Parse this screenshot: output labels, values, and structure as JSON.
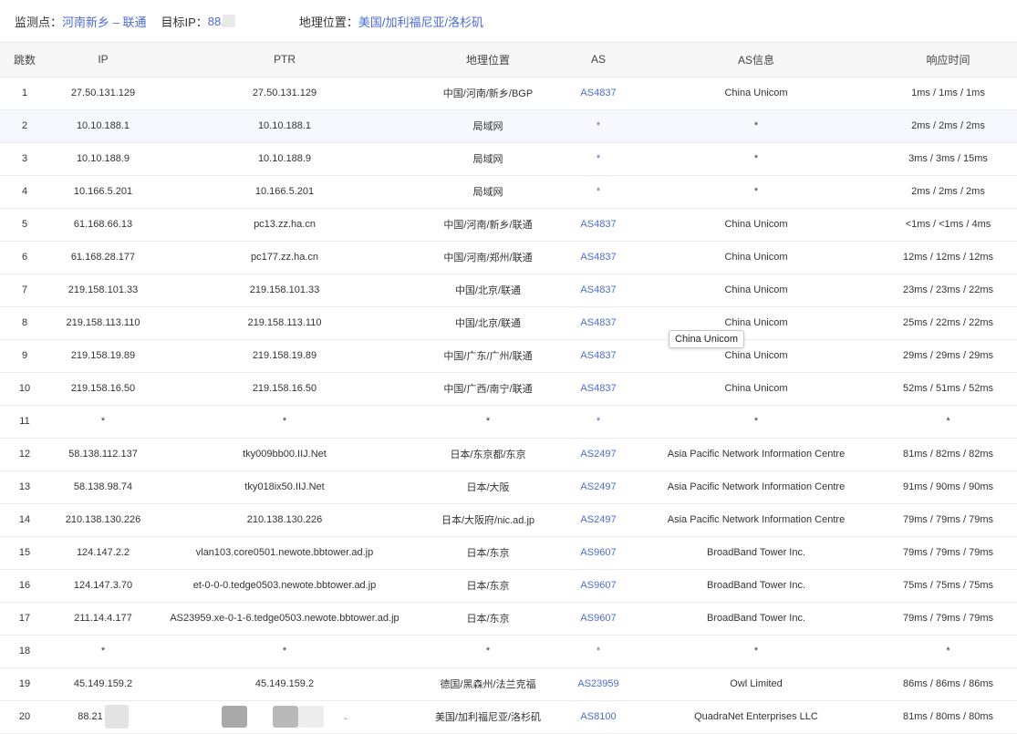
{
  "header": {
    "monitor_label": "监测点：",
    "monitor_value": "河南新乡 – 联通",
    "target_label": "目标IP：",
    "target_value": "88.",
    "geo_label": "地理位置：",
    "geo_value": "美国/加利福尼亚/洛杉矶"
  },
  "table": {
    "columns": [
      "跳数",
      "IP",
      "PTR",
      "地理位置",
      "AS",
      "AS信息",
      "响应时间"
    ],
    "rows": [
      {
        "hop": "1",
        "ip": "27.50.131.129",
        "ptr": "27.50.131.129",
        "geo": "中国/河南/新乡/BGP",
        "as": "AS4837",
        "asinfo": "China Unicom",
        "time": "1ms / 1ms / 1ms"
      },
      {
        "hop": "2",
        "ip": "10.10.188.1",
        "ptr": "10.10.188.1",
        "geo": "局域网",
        "as": "*",
        "asinfo": "*",
        "time": "2ms / 2ms / 2ms"
      },
      {
        "hop": "3",
        "ip": "10.10.188.9",
        "ptr": "10.10.188.9",
        "geo": "局域网",
        "as": "*",
        "asinfo": "*",
        "time": "3ms / 3ms / 15ms"
      },
      {
        "hop": "4",
        "ip": "10.166.5.201",
        "ptr": "10.166.5.201",
        "geo": "局域网",
        "as": "*",
        "asinfo": "*",
        "time": "2ms / 2ms / 2ms"
      },
      {
        "hop": "5",
        "ip": "61.168.66.13",
        "ptr": "pc13.zz.ha.cn",
        "geo": "中国/河南/新乡/联通",
        "as": "AS4837",
        "asinfo": "China Unicom",
        "time": "<1ms / <1ms / 4ms"
      },
      {
        "hop": "6",
        "ip": "61.168.28.177",
        "ptr": "pc177.zz.ha.cn",
        "geo": "中国/河南/郑州/联通",
        "as": "AS4837",
        "asinfo": "China Unicom",
        "time": "12ms / 12ms / 12ms"
      },
      {
        "hop": "7",
        "ip": "219.158.101.33",
        "ptr": "219.158.101.33",
        "geo": "中国/北京/联通",
        "as": "AS4837",
        "asinfo": "China Unicom",
        "time": "23ms / 23ms / 22ms"
      },
      {
        "hop": "8",
        "ip": "219.158.113.110",
        "ptr": "219.158.113.110",
        "geo": "中国/北京/联通",
        "as": "AS4837",
        "asinfo": "China Unicom",
        "time": "25ms / 22ms / 22ms"
      },
      {
        "hop": "9",
        "ip": "219.158.19.89",
        "ptr": "219.158.19.89",
        "geo": "中国/广东/广州/联通",
        "as": "AS4837",
        "asinfo": "China Unicom",
        "time": "29ms / 29ms / 29ms"
      },
      {
        "hop": "10",
        "ip": "219.158.16.50",
        "ptr": "219.158.16.50",
        "geo": "中国/广西/南宁/联通",
        "as": "AS4837",
        "asinfo": "China Unicom",
        "time": "52ms / 51ms / 52ms"
      },
      {
        "hop": "11",
        "ip": "*",
        "ptr": "*",
        "geo": "*",
        "as": "*",
        "asinfo": "*",
        "time": "*"
      },
      {
        "hop": "12",
        "ip": "58.138.112.137",
        "ptr": "tky009bb00.IIJ.Net",
        "geo": "日本/东京都/东京",
        "as": "AS2497",
        "asinfo": "Asia Pacific Network Information Centre",
        "time": "81ms / 82ms / 82ms"
      },
      {
        "hop": "13",
        "ip": "58.138.98.74",
        "ptr": "tky018ix50.IIJ.Net",
        "geo": "日本/大阪",
        "as": "AS2497",
        "asinfo": "Asia Pacific Network Information Centre",
        "time": "91ms / 90ms / 90ms"
      },
      {
        "hop": "14",
        "ip": "210.138.130.226",
        "ptr": "210.138.130.226",
        "geo": "日本/大阪府/nic.ad.jp",
        "as": "AS2497",
        "asinfo": "Asia Pacific Network Information Centre",
        "time": "79ms / 79ms / 79ms"
      },
      {
        "hop": "15",
        "ip": "124.147.2.2",
        "ptr": "vlan103.core0501.newote.bbtower.ad.jp",
        "geo": "日本/东京",
        "as": "AS9607",
        "asinfo": "BroadBand Tower Inc.",
        "time": "79ms / 79ms / 79ms"
      },
      {
        "hop": "16",
        "ip": "124.147.3.70",
        "ptr": "et-0-0-0.tedge0503.newote.bbtower.ad.jp",
        "geo": "日本/东京",
        "as": "AS9607",
        "asinfo": "BroadBand Tower Inc.",
        "time": "75ms / 75ms / 75ms"
      },
      {
        "hop": "17",
        "ip": "211.14.4.177",
        "ptr": "AS23959.xe-0-1-6.tedge0503.newote.bbtower.ad.jp",
        "geo": "日本/东京",
        "as": "AS9607",
        "asinfo": "BroadBand Tower Inc.",
        "time": "79ms / 79ms / 79ms"
      },
      {
        "hop": "18",
        "ip": "*",
        "ptr": "*",
        "geo": "*",
        "as": "*",
        "asinfo": "*",
        "time": "*"
      },
      {
        "hop": "19",
        "ip": "45.149.159.2",
        "ptr": "45.149.159.2",
        "geo": "德国/黑森州/法兰克福",
        "as": "AS23959",
        "asinfo": "Owl Limited",
        "time": "86ms / 86ms / 86ms"
      },
      {
        "hop": "20",
        "ip": "88.21",
        "ptr": ".",
        "geo": "美国/加利福尼亚/洛杉矶",
        "as": "AS8100",
        "asinfo": "QuadraNet Enterprises LLC",
        "time": "81ms / 80ms / 80ms"
      }
    ]
  },
  "tooltip": {
    "text": "China Unicom"
  }
}
